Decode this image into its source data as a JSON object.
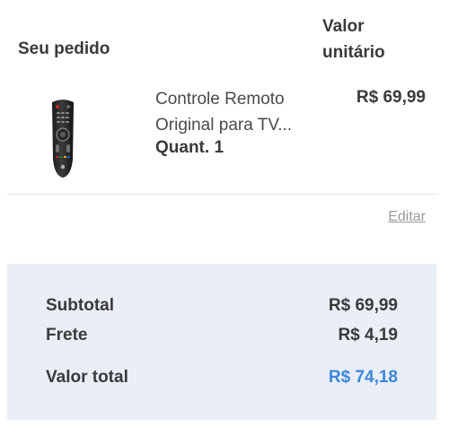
{
  "header": {
    "order_label": "Seu pedido",
    "unit_value_line1": "Valor",
    "unit_value_line2": "unitário"
  },
  "product": {
    "image_icon": "tv-remote-control-image",
    "name_line1": "Controle Remoto",
    "name_line2": "Original para TV...",
    "quantity": "Quant. 1",
    "unit_price": "R$ 69,99"
  },
  "actions": {
    "edit_label": "Editar"
  },
  "summary": {
    "subtotal_label": "Subtotal",
    "subtotal_value": "R$ 69,99",
    "shipping_label": "Frete",
    "shipping_value": "R$ 4,19",
    "total_label": "Valor total",
    "total_value": "R$ 74,18"
  },
  "colors": {
    "summary_background": "#e9eef7",
    "total_accent": "#3b86d8",
    "text": "#3a3a3a",
    "link": "#9a9a9a"
  }
}
